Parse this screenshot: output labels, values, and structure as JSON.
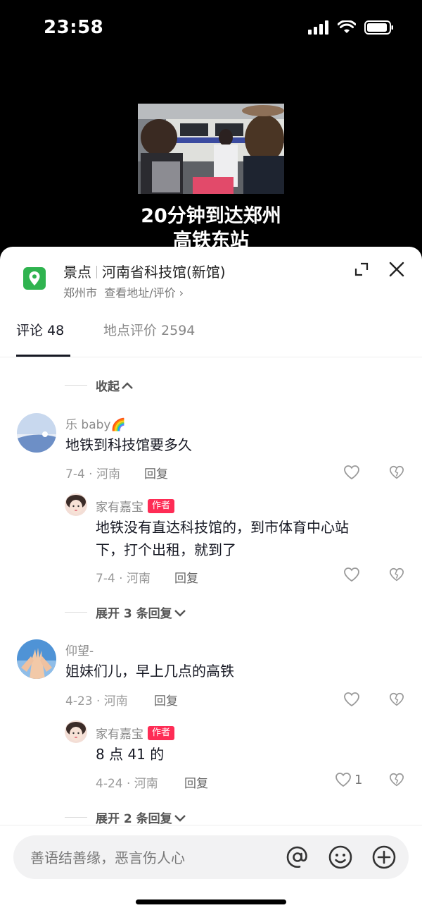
{
  "status_bar": {
    "time": "23:58"
  },
  "video": {
    "caption_line1": "20分钟到达郑州",
    "caption_line2": "高铁东站"
  },
  "poi": {
    "category": "景点",
    "name": "河南省科技馆(新馆)",
    "city": "郑州市",
    "link": "查看地址/评价 ›"
  },
  "tabs": [
    {
      "label": "评论 48"
    },
    {
      "label": "地点评价 2594"
    }
  ],
  "collapse_label": "收起",
  "comments": [
    {
      "user": "乐 baby🌈",
      "text": "地铁到科技馆要多久",
      "meta": "7-4 · 河南",
      "reply_label": "回复",
      "reply": {
        "user": "家有嘉宝",
        "badge": "作者",
        "text_line1": "地铁没有直达科技馆的，到市体育中心站",
        "text_line2": "下，打个出租，就到了",
        "meta": "7-4 · 河南",
        "reply_label": "回复"
      },
      "expand_label": "展开 3 条回复"
    },
    {
      "user": "仰望-",
      "text": "姐妹们儿，早上几点的高铁",
      "meta": "4-23 · 河南",
      "reply_label": "回复",
      "reply": {
        "user": "家有嘉宝",
        "badge": "作者",
        "text_line1": "8 点 41 的",
        "meta": "4-24 · 河南",
        "reply_label": "回复",
        "likes": "1"
      },
      "expand_label": "展开 2 条回复"
    }
  ],
  "input": {
    "placeholder": "善语结善缘，恶言伤人心"
  },
  "colors": {
    "accent": "#fe2c55",
    "pin": "#2fb34f"
  }
}
